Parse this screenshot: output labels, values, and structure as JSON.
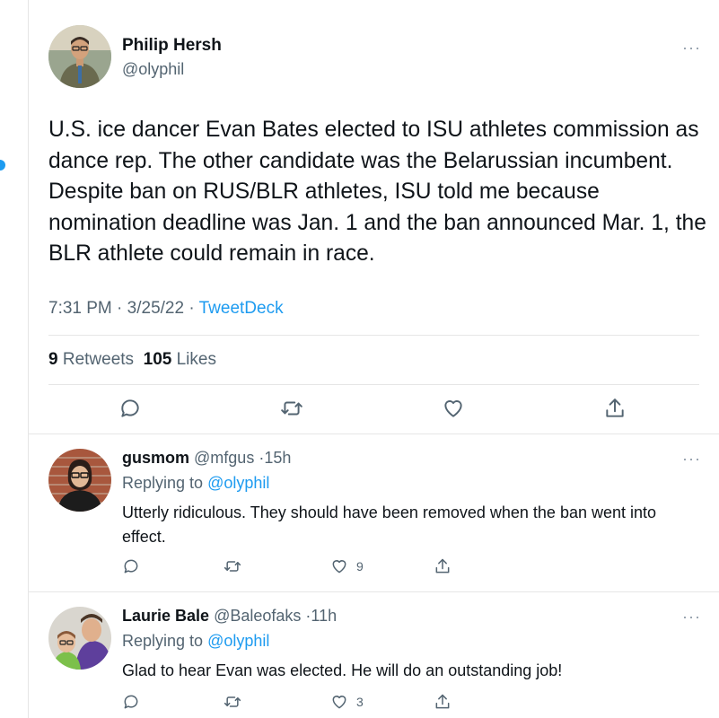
{
  "colors": {
    "accent": "#1d9bf0",
    "text": "#0f1419",
    "muted": "#536471",
    "divider": "#e6e6e6"
  },
  "tweet": {
    "author_name": "Philip Hersh",
    "author_handle": "@olyphil",
    "text": "U.S. ice dancer Evan Bates elected to ISU athletes commission as dance rep.  The other candidate was the Belarussian incumbent.  Despite ban on RUS/BLR athletes, ISU told me because nomination deadline was Jan. 1 and the ban announced Mar. 1, the BLR athlete could remain in race.",
    "time": "7:31 PM",
    "date": "3/25/22",
    "sep": "·",
    "source": "TweetDeck",
    "retweets_count": "9",
    "retweets_label": "Retweets",
    "likes_count": "105",
    "likes_label": "Likes",
    "more_icon": "more-icon"
  },
  "replies": [
    {
      "name": "gusmom",
      "handle": "@mfgus",
      "age": "15h",
      "replying_prefix": "Replying to",
      "replying_to": "@olyphil",
      "text": "Utterly ridiculous. They should have been removed when the ban went into effect.",
      "like_count": "9"
    },
    {
      "name": "Laurie Bale",
      "handle": "@Baleofaks",
      "age": "11h",
      "replying_prefix": "Replying to",
      "replying_to": "@olyphil",
      "text": "Glad to hear Evan was elected. He will do an outstanding job!",
      "like_count": "3"
    }
  ],
  "more_dots": "···"
}
